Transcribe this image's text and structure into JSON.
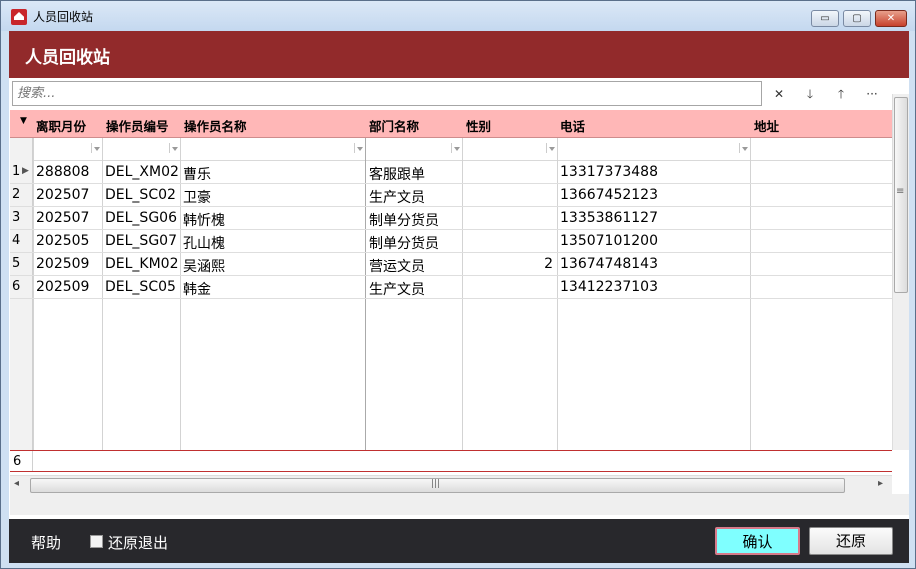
{
  "window": {
    "title": "人员回收站",
    "min": "▭",
    "max": "▢",
    "close": "✕"
  },
  "header": {
    "title": "人员回收站"
  },
  "search": {
    "placeholder": "搜索...",
    "clear": "✕",
    "down": "🡓",
    "up": "🡑",
    "more": "···"
  },
  "columns": [
    "离职月份",
    "操作员编号",
    "操作员名称",
    "部门名称",
    "性别",
    "电话",
    "地址"
  ],
  "rows": [
    {
      "idx": "1",
      "month": "288808",
      "code": "DEL_XM02",
      "name": "曹乐",
      "dept": "客服跟单",
      "gender": "",
      "phone": "13317373488",
      "addr": ""
    },
    {
      "idx": "2",
      "month": "202507",
      "code": "DEL_SC02",
      "name": "卫豪",
      "dept": "生产文员",
      "gender": "",
      "phone": "13667452123",
      "addr": ""
    },
    {
      "idx": "3",
      "month": "202507",
      "code": "DEL_SG06",
      "name": "韩忻槐",
      "dept": "制单分货员",
      "gender": "",
      "phone": "13353861127",
      "addr": ""
    },
    {
      "idx": "4",
      "month": "202505",
      "code": "DEL_SG07",
      "name": "孔山槐",
      "dept": "制单分货员",
      "gender": "",
      "phone": "13507101200",
      "addr": ""
    },
    {
      "idx": "5",
      "month": "202509",
      "code": "DEL_KM02",
      "name": "吴涵熙",
      "dept": "营运文员",
      "gender": "2",
      "phone": "13674748143",
      "addr": ""
    },
    {
      "idx": "6",
      "month": "202509",
      "code": "DEL_SC05",
      "name": "韩金",
      "dept": "生产文员",
      "gender": "",
      "phone": "13412237103",
      "addr": ""
    }
  ],
  "footer": {
    "count": "6"
  },
  "scroll": {
    "h_grip": "|||",
    "v_grip": "≡",
    "left": "◂",
    "right": "▸"
  },
  "bottom": {
    "help": "帮助",
    "restore_exit": "还原退出",
    "confirm": "确认",
    "restore": "还原"
  }
}
